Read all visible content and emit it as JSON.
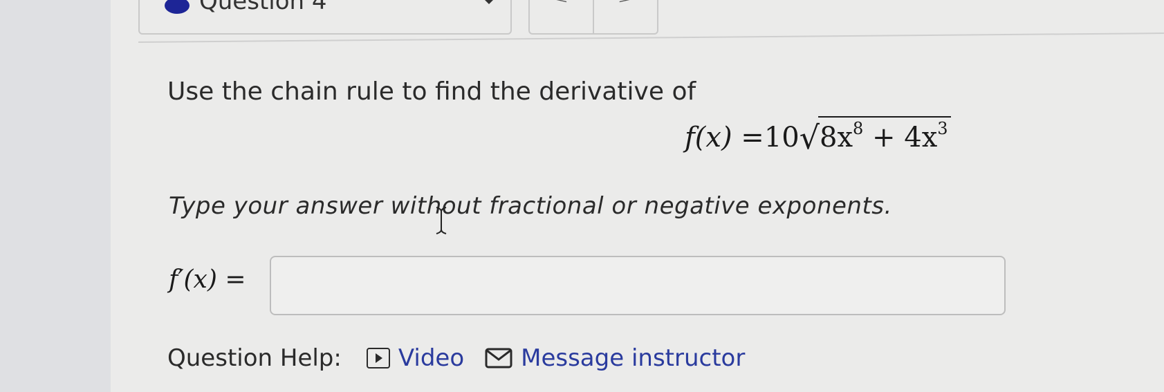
{
  "header": {
    "question_label": "Question 4",
    "prev_symbol": "<",
    "next_symbol": ">"
  },
  "question": {
    "instruction": "Use the chain rule to find the derivative of",
    "formula": {
      "lhs": "f(x) =",
      "coefficient": "10",
      "radicand_a": "8x",
      "exp_a": "8",
      "op": " + ",
      "radicand_b": "4x",
      "exp_b": "3"
    },
    "note": "Type your answer without fractional or negative exponents.",
    "answer_label": "f′(x) =",
    "answer_value": ""
  },
  "help": {
    "label": "Question Help:",
    "video_label": "Video",
    "message_label": "Message instructor"
  },
  "colors": {
    "question_dot": "#1d2596",
    "link": "#2a3b9e"
  }
}
